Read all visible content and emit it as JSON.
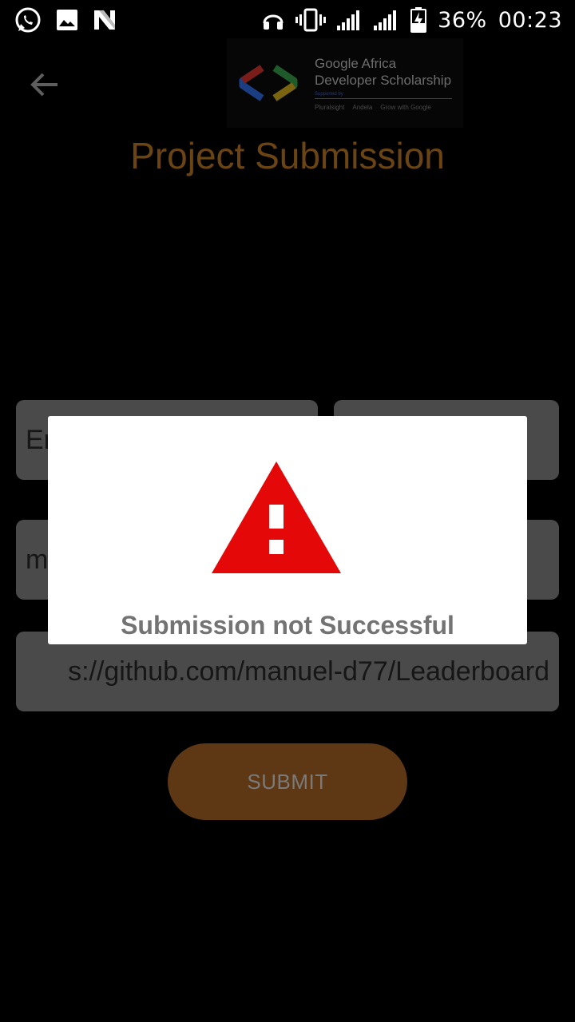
{
  "status_bar": {
    "battery": "36%",
    "time": "00:23",
    "left_icons": [
      "whatsapp-icon",
      "gallery-icon",
      "n-notification-icon"
    ],
    "right_icons": [
      "headphones-icon",
      "vibrate-icon",
      "signal-icon",
      "signal-icon",
      "battery-charging-icon"
    ]
  },
  "header": {
    "back_icon": "arrow-left-icon",
    "banner": {
      "title_line1": "Google Africa",
      "title_line2": "Developer Scholarship",
      "supported_by": "Supported by",
      "sponsors": [
        "Pluralsight",
        "Andela",
        "Grow with Google"
      ]
    },
    "title": "Project Submission"
  },
  "form": {
    "first_name_value": "En",
    "last_name_value": "",
    "email_value": "m",
    "github_link_value": "s://github.com/manuel-d77/Leaderboard",
    "submit_label": "SUBMIT"
  },
  "dialog": {
    "icon": "warning-triangle-icon",
    "message": "Submission not Successful"
  },
  "colors": {
    "accent": "#b26a1e",
    "dimmed_accent": "#6b4414",
    "warning_red": "#e50808",
    "dialog_text": "#737373"
  }
}
